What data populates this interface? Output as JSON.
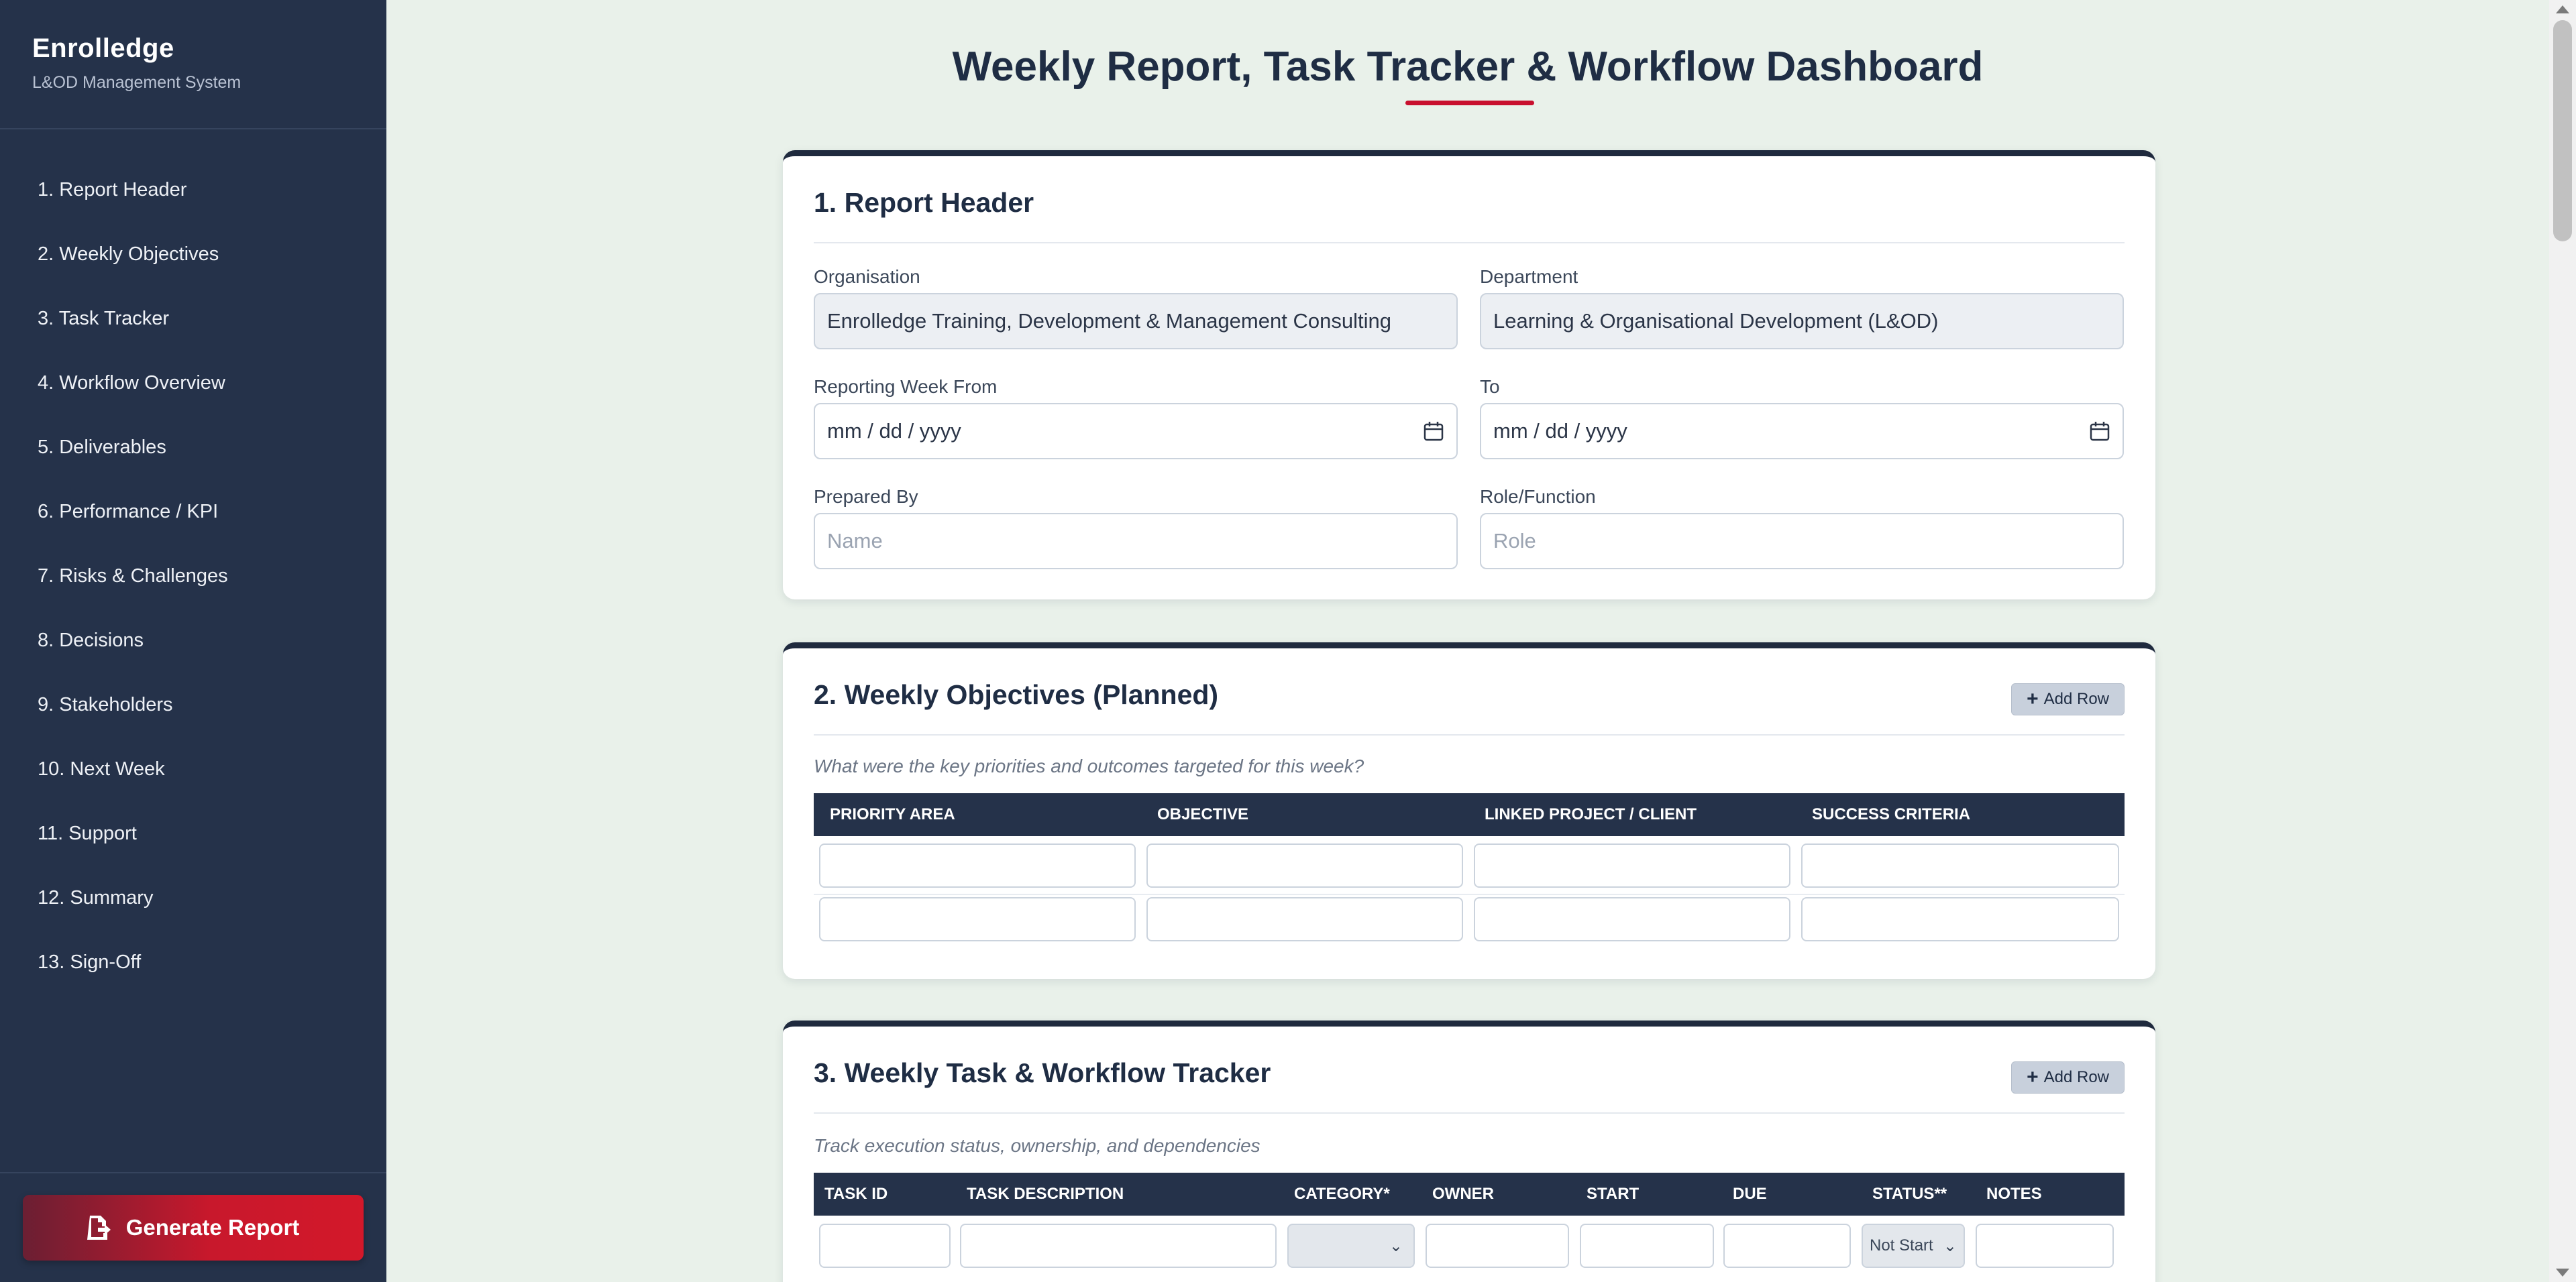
{
  "brand": {
    "title": "Enrolledge",
    "subtitle": "L&OD Management System"
  },
  "sidebar": {
    "items": [
      {
        "label": "1. Report Header"
      },
      {
        "label": "2. Weekly Objectives"
      },
      {
        "label": "3. Task Tracker"
      },
      {
        "label": "4. Workflow Overview"
      },
      {
        "label": "5. Deliverables"
      },
      {
        "label": "6. Performance / KPI"
      },
      {
        "label": "7. Risks & Challenges"
      },
      {
        "label": "8. Decisions"
      },
      {
        "label": "9. Stakeholders"
      },
      {
        "label": "10. Next Week"
      },
      {
        "label": "11. Support"
      },
      {
        "label": "12. Summary"
      },
      {
        "label": "13. Sign-Off"
      }
    ],
    "generate_label": "Generate Report",
    "generate_icon": "file-export-icon"
  },
  "page": {
    "title": "Weekly Report, Task Tracker & Workflow Dashboard",
    "accent_color": "#c8102e"
  },
  "report_header": {
    "title": "1. Report Header",
    "organisation_label": "Organisation",
    "organisation_value": "Enrolledge Training, Development & Management Consulting",
    "department_label": "Department",
    "department_value": "Learning & Organisational Development (L&OD)",
    "week_from_label": "Reporting Week From",
    "week_from_placeholder": "mm / dd / yyyy",
    "to_label": "To",
    "to_placeholder": "mm / dd / yyyy",
    "prepared_by_label": "Prepared By",
    "prepared_by_placeholder": "Name",
    "role_label": "Role/Function",
    "role_placeholder": "Role"
  },
  "objectives": {
    "title": "2. Weekly Objectives (Planned)",
    "add_row_label": "Add Row",
    "description": "What were the key priorities and outcomes targeted for this week?",
    "columns": [
      "PRIORITY AREA",
      "OBJECTIVE",
      "LINKED PROJECT / CLIENT",
      "SUCCESS CRITERIA"
    ]
  },
  "tracker": {
    "title": "3. Weekly Task & Workflow Tracker",
    "add_row_label": "Add Row",
    "description": "Track execution status, ownership, and dependencies",
    "columns": [
      "TASK ID",
      "TASK DESCRIPTION",
      "CATEGORY*",
      "OWNER",
      "START",
      "DUE",
      "STATUS**",
      "NOTES"
    ],
    "status_value": "Not Start"
  }
}
